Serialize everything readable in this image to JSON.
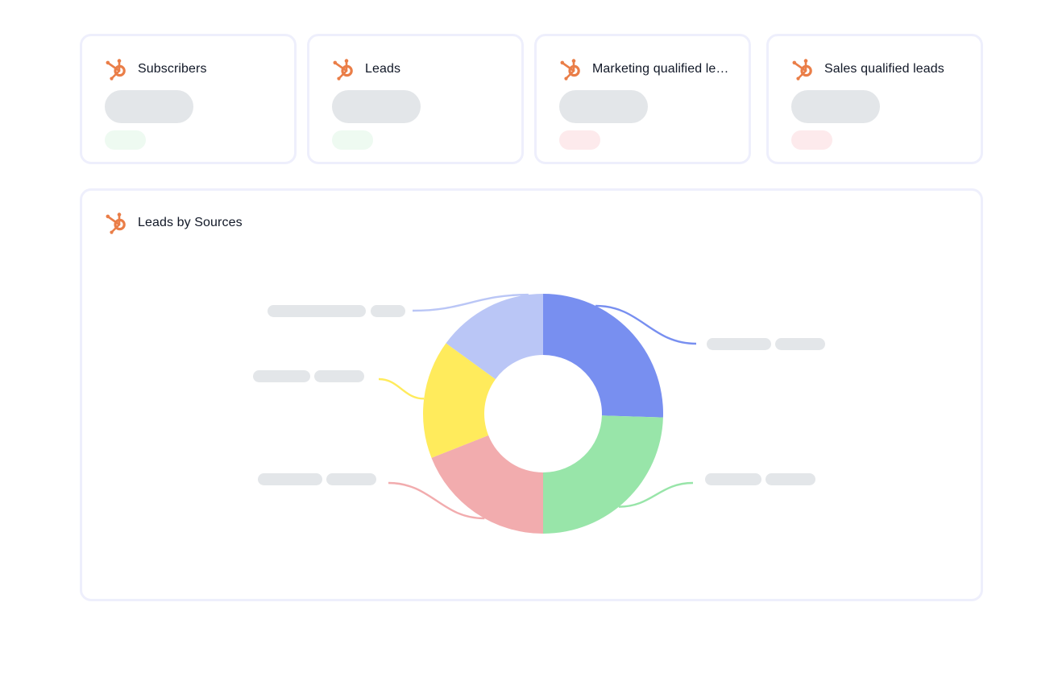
{
  "kpis": [
    {
      "title": "Subscribers",
      "trend_color": "#eefaf1"
    },
    {
      "title": "Leads",
      "trend_color": "#eefaf1"
    },
    {
      "title": "Marketing qualified leads",
      "trend_color": "#fdeaec"
    },
    {
      "title": "Sales qualified leads",
      "trend_color": "#fdeaec"
    }
  ],
  "chart_panel": {
    "title": "Leads by Sources"
  },
  "colors": {
    "logo": "#ea7e48",
    "skeleton": "#e3e6e9",
    "border": "#eeeffc"
  },
  "chart_data": {
    "type": "pie",
    "donut": true,
    "slices": [
      {
        "value": 25.5,
        "color": "#788ff0"
      },
      {
        "value": 24.5,
        "color": "#98e5a9"
      },
      {
        "value": 19.0,
        "color": "#f2acae"
      },
      {
        "value": 16.0,
        "color": "#ffeb5c"
      },
      {
        "value": 15.0,
        "color": "#bac6f6"
      }
    ],
    "legend_labels": "hidden (skeleton placeholders)"
  }
}
